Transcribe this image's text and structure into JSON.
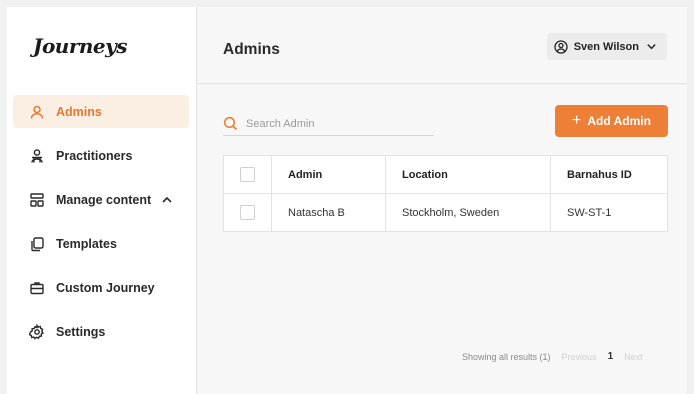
{
  "app": {
    "logo_text": "Journeys"
  },
  "sidebar": {
    "items": [
      {
        "label": "Admins",
        "icon": "user-icon",
        "active": true
      },
      {
        "label": "Practitioners",
        "icon": "users-icon"
      },
      {
        "label": "Manage content",
        "icon": "layout-icon",
        "expanded": true
      },
      {
        "label": "Templates",
        "icon": "copy-icon"
      },
      {
        "label": "Custom Journey",
        "icon": "briefcase-icon"
      },
      {
        "label": "Settings",
        "icon": "gear-icon"
      }
    ]
  },
  "header": {
    "title": "Admins",
    "user_name": "Sven Wilson"
  },
  "toolbar": {
    "search_placeholder": "Search Admin",
    "add_label": "Add Admin"
  },
  "table": {
    "columns": [
      "Admin",
      "Location",
      "Barnahus ID"
    ],
    "rows": [
      {
        "admin": "Natascha B",
        "location": "Stockholm, Sweden",
        "barnahus_id": "SW-ST-1"
      }
    ]
  },
  "pagination": {
    "summary": "Showing all results (1)",
    "prev_label": "Previous",
    "current_page": "1",
    "next_label": "Next"
  },
  "colors": {
    "accent": "#ed7f36",
    "active_bg": "#fbeee3",
    "active_text": "#e8782e"
  }
}
